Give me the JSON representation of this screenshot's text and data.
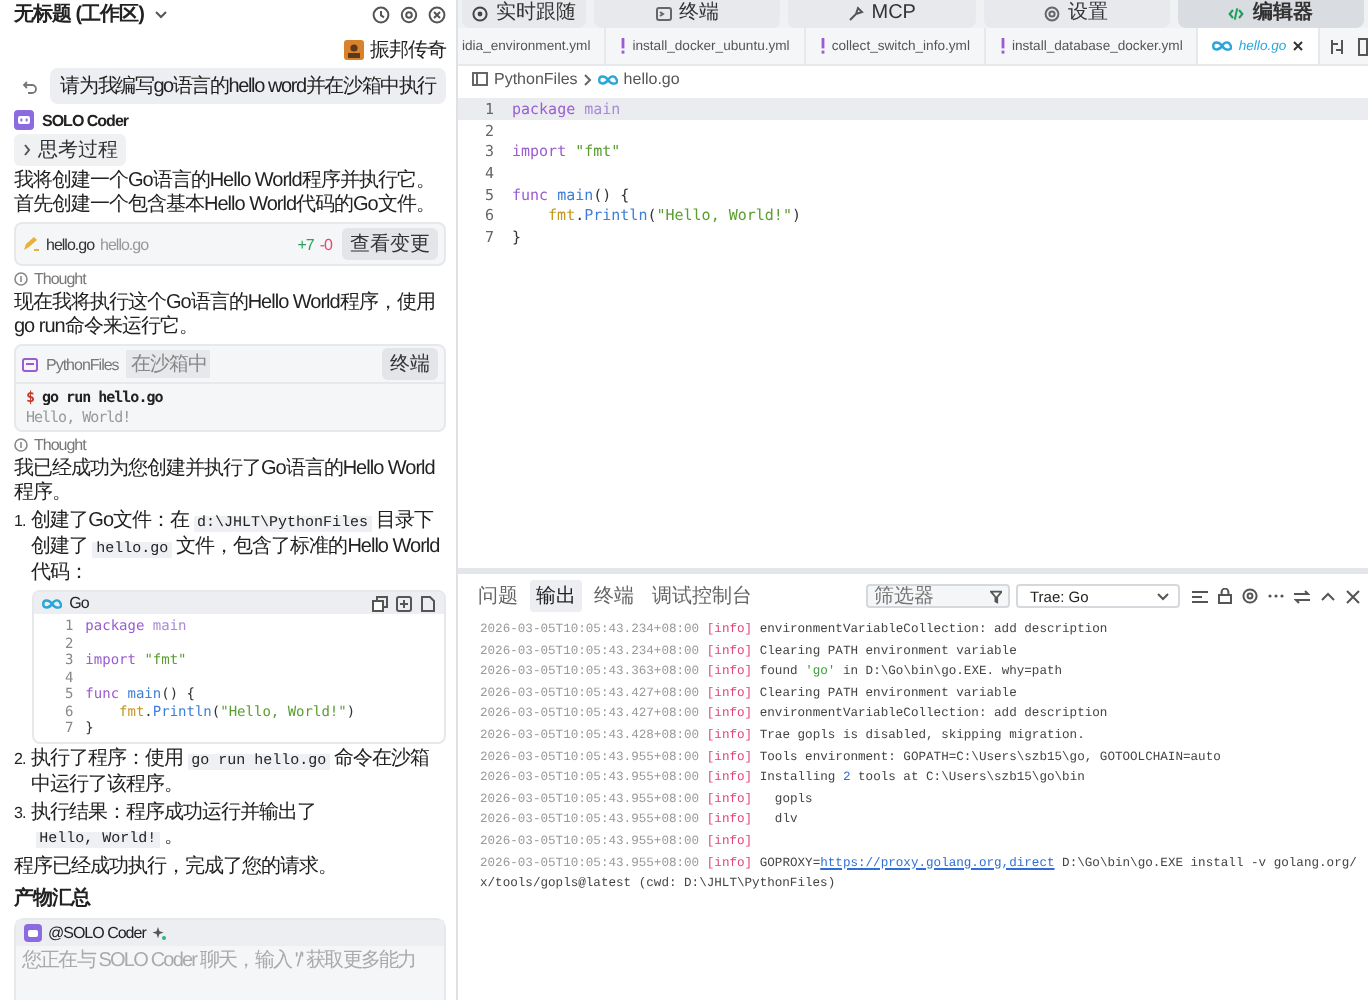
{
  "chat": {
    "workspace_title": "无标题 (工作区)",
    "user": {
      "name": "振邦传奇"
    },
    "user_message": "请为我编写go语言的hello word并在沙箱中执行",
    "agent": {
      "name": "SOLO Coder"
    },
    "messages": [
      {
        "kind": "thinking_toggle",
        "label": "思考过程",
        "expanded": false
      },
      {
        "kind": "paragraph",
        "text": "我将创建一个Go语言的Hello World程序并执行它。首先创建一个包含基本Hello World代码的Go文件。"
      },
      {
        "kind": "file_card",
        "file": "hello.go",
        "path": "hello.go",
        "added": "+7",
        "removed": "-0",
        "button": "查看变更"
      },
      {
        "kind": "thought",
        "label": "Thought"
      },
      {
        "kind": "paragraph",
        "text": "现在我将执行这个Go语言的Hello World程序，使用go run命令来运行它。"
      },
      {
        "kind": "terminal_card",
        "folder": "PythonFiles",
        "badge": "在沙箱中",
        "button": "终端",
        "prompt": "$",
        "command": "go run hello.go",
        "output": "Hello, World!"
      },
      {
        "kind": "thought",
        "label": "Thought"
      },
      {
        "kind": "paragraph",
        "text": "我已经成功为您创建并执行了Go语言的Hello World程序。"
      },
      {
        "kind": "list",
        "items": [
          {
            "number": "1.",
            "parts": [
              {
                "kind": "text",
                "text": "创建了Go文件：在"
              },
              {
                "kind": "code",
                "text": "d:\\JHLT\\PythonFiles"
              },
              {
                "kind": "text",
                "text": "目录下创建了"
              },
              {
                "kind": "code",
                "text": "hello.go"
              },
              {
                "kind": "text",
                "text": "文件，包含了标准的Hello World代码："
              }
            ],
            "code_block": {
              "language": "Go",
              "lines": [
                {
                  "number": "1",
                  "tokens": [
                    {
                      "kind": "keyword",
                      "text": "package "
                    },
                    {
                      "kind": "name",
                      "text": "main"
                    }
                  ]
                },
                {
                  "number": "2"
                },
                {
                  "number": "3",
                  "tokens": [
                    {
                      "kind": "keyword",
                      "text": "import "
                    },
                    {
                      "kind": "string",
                      "text": "\"fmt\""
                    }
                  ]
                },
                {
                  "number": "4"
                },
                {
                  "number": "5",
                  "tokens": [
                    {
                      "kind": "keyword",
                      "text": "func "
                    },
                    {
                      "kind": "function",
                      "text": "main"
                    },
                    {
                      "kind": "plain",
                      "text": "() {"
                    }
                  ]
                },
                {
                  "number": "6",
                  "indent": true,
                  "tokens": [
                    {
                      "kind": "package",
                      "text": "fmt"
                    },
                    {
                      "kind": "plain",
                      "text": "."
                    },
                    {
                      "kind": "function",
                      "text": "Println"
                    },
                    {
                      "kind": "plain",
                      "text": "("
                    },
                    {
                      "kind": "string",
                      "text": "\"Hello, World!\""
                    },
                    {
                      "kind": "plain",
                      "text": ")"
                    }
                  ]
                },
                {
                  "number": "7",
                  "tokens": [
                    {
                      "kind": "plain",
                      "text": "}"
                    }
                  ]
                }
              ]
            }
          },
          {
            "number": "2.",
            "parts": [
              {
                "kind": "text",
                "text": "执行了程序：使用"
              },
              {
                "kind": "code",
                "text": "go run hello.go"
              },
              {
                "kind": "text",
                "text": "命令在沙箱中运行了该程序。"
              }
            ]
          },
          {
            "number": "3.",
            "parts": [
              {
                "kind": "text",
                "text": "执行结果：程序成功运行并输出了"
              },
              {
                "kind": "code",
                "text": "Hello, World!"
              },
              {
                "kind": "text",
                "text": "。"
              }
            ]
          }
        ]
      },
      {
        "kind": "paragraph",
        "text": "程序已经成功执行，完成了您的请求。"
      },
      {
        "kind": "heading",
        "text": "产物汇总"
      }
    ],
    "chat_input": {
      "mention": "@SOLO Coder",
      "placeholder": "您正在与 SOLO Coder 聊天，输入 '/' 获取更多能力"
    }
  },
  "toolbar": [
    {
      "label": "实时跟随",
      "selected": false
    },
    {
      "label": "终端",
      "selected": false
    },
    {
      "label": "MCP",
      "selected": false
    },
    {
      "label": "设置",
      "selected": false
    },
    {
      "label": "编辑器",
      "selected": true
    }
  ],
  "editor_tabs": [
    {
      "label": "idia_environment.yml",
      "kind": "yaml",
      "selected": false
    },
    {
      "label": "install_docker_ubuntu.yml",
      "kind": "yaml",
      "selected": false
    },
    {
      "label": "collect_switch_info.yml",
      "kind": "yaml",
      "selected": false
    },
    {
      "label": "install_database_docker.yml",
      "kind": "yaml",
      "selected": false
    },
    {
      "label": "hello.go",
      "kind": "go",
      "selected": true
    }
  ],
  "breadcrumb": [
    "PythonFiles",
    "hello.go"
  ],
  "editor": {
    "lines": [
      {
        "number": "1",
        "current": true,
        "tokens": [
          {
            "kind": "keyword",
            "text": "package "
          },
          {
            "kind": "name",
            "text": "main"
          }
        ]
      },
      {
        "number": "2",
        "current": false
      },
      {
        "number": "3",
        "current": false,
        "tokens": [
          {
            "kind": "keyword",
            "text": "import "
          },
          {
            "kind": "string",
            "text": "\"fmt\""
          }
        ]
      },
      {
        "number": "4",
        "current": false
      },
      {
        "number": "5",
        "current": false,
        "tokens": [
          {
            "kind": "keyword",
            "text": "func "
          },
          {
            "kind": "function",
            "text": "main"
          },
          {
            "kind": "plain",
            "text": "() {"
          }
        ]
      },
      {
        "number": "6",
        "current": false,
        "indent": true,
        "tokens": [
          {
            "kind": "package",
            "text": "fmt"
          },
          {
            "kind": "plain",
            "text": "."
          },
          {
            "kind": "function",
            "text": "Println"
          },
          {
            "kind": "plain",
            "text": "("
          },
          {
            "kind": "string",
            "text": "\"Hello, World!\""
          },
          {
            "kind": "plain",
            "text": ")"
          }
        ]
      },
      {
        "number": "7",
        "current": false,
        "tokens": [
          {
            "kind": "plain",
            "text": "}"
          }
        ]
      }
    ]
  },
  "panel": {
    "tabs": [
      {
        "label": "问题",
        "selected": false
      },
      {
        "label": "输出",
        "selected": true
      },
      {
        "label": "终端",
        "selected": false
      },
      {
        "label": "调试控制台",
        "selected": false
      }
    ],
    "filter": {
      "placeholder": "筛选器"
    },
    "channel": "Trae: Go",
    "log": [
      {
        "time": "2026-03-05T10:05:43.234+08:00",
        "level": "[info]",
        "parts": [
          {
            "kind": "text",
            "text": "environmentVariableCollection: add description"
          }
        ]
      },
      {
        "time": "2026-03-05T10:05:43.234+08:00",
        "level": "[info]",
        "parts": [
          {
            "kind": "text",
            "text": "Clearing PATH environment variable"
          }
        ]
      },
      {
        "time": "2026-03-05T10:05:43.363+08:00",
        "level": "[info]",
        "parts": [
          {
            "kind": "text",
            "text": "found "
          },
          {
            "kind": "string",
            "text": "'go'"
          },
          {
            "kind": "text",
            "text": " in D:\\Go\\bin\\go.EXE. why=path"
          }
        ]
      },
      {
        "time": "2026-03-05T10:05:43.427+08:00",
        "level": "[info]",
        "parts": [
          {
            "kind": "text",
            "text": "Clearing PATH environment variable"
          }
        ]
      },
      {
        "time": "2026-03-05T10:05:43.427+08:00",
        "level": "[info]",
        "parts": [
          {
            "kind": "text",
            "text": "environmentVariableCollection: add description"
          }
        ]
      },
      {
        "time": "2026-03-05T10:05:43.428+08:00",
        "level": "[info]",
        "parts": [
          {
            "kind": "text",
            "text": "Trae gopls is disabled, skipping migration."
          }
        ]
      },
      {
        "time": "2026-03-05T10:05:43.955+08:00",
        "level": "[info]",
        "parts": [
          {
            "kind": "text",
            "text": "Tools environment: GOPATH=C:\\Users\\szb15\\go, GOTOOLCHAIN=auto"
          }
        ]
      },
      {
        "time": "2026-03-05T10:05:43.955+08:00",
        "level": "[info]",
        "parts": [
          {
            "kind": "text",
            "text": "Installing "
          },
          {
            "kind": "number",
            "text": "2"
          },
          {
            "kind": "text",
            "text": " tools at C:\\Users\\szb15\\go\\bin"
          }
        ]
      },
      {
        "time": "2026-03-05T10:05:43.955+08:00",
        "level": "[info]",
        "parts": [
          {
            "kind": "text",
            "text": "  gopls"
          }
        ]
      },
      {
        "time": "2026-03-05T10:05:43.955+08:00",
        "level": "[info]",
        "parts": [
          {
            "kind": "text",
            "text": "  dlv"
          }
        ]
      },
      {
        "time": "2026-03-05T10:05:43.955+08:00",
        "level": "[info]"
      },
      {
        "time": "2026-03-05T10:05:43.955+08:00",
        "level": "[info]",
        "parts": [
          {
            "kind": "text",
            "text": "GOPROXY="
          },
          {
            "kind": "link",
            "text": "https://proxy.golang.org,direct"
          },
          {
            "kind": "text",
            "text": " D:\\Go\\bin\\go.EXE install -v golang.org/x/tools/gopls@latest (cwd: D:\\JHLT\\PythonFiles)"
          }
        ]
      }
    ]
  }
}
